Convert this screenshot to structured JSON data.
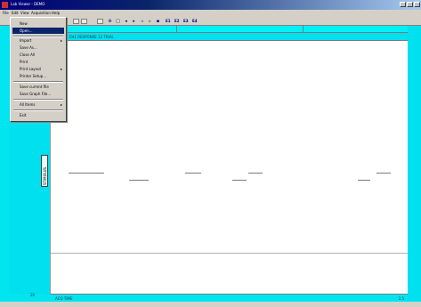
{
  "window": {
    "title": "Lab Viewer - DEMO",
    "accent": "#0a246a",
    "frame_color": "#00e5f0"
  },
  "menubar": {
    "items": [
      "File",
      "Edit",
      "View",
      "Acquisition",
      "Help"
    ]
  },
  "toolbar": {
    "labels": [
      "E1",
      "E2",
      "E3",
      "E4"
    ]
  },
  "file_menu": {
    "items": [
      {
        "label": "New",
        "has_submenu": false
      },
      {
        "label": "Open...",
        "has_submenu": false
      },
      {
        "label": "Import",
        "has_submenu": true
      },
      {
        "label": "Save As...",
        "has_submenu": false
      },
      {
        "label": "Close All",
        "has_submenu": false
      },
      {
        "label": "Print",
        "has_submenu": false
      },
      {
        "label": "Print Layout",
        "has_submenu": true
      },
      {
        "label": "Printer Setup...",
        "has_submenu": false
      },
      {
        "label": "Save current file",
        "has_submenu": false
      },
      {
        "label": "Save Graph File...",
        "has_submenu": false
      },
      {
        "label": "All Items",
        "has_submenu": true
      },
      {
        "label": "Exit",
        "has_submenu": false
      }
    ]
  },
  "header": {
    "text": "Sample: CH1 RESPONSE 12 TRIAL"
  },
  "side_label": {
    "text": "STIMULUS"
  },
  "bottom": {
    "left_number": "20",
    "label": "ACQ TIME",
    "right": "2.5"
  }
}
